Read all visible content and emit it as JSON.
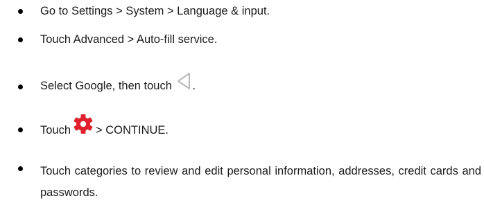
{
  "steps": [
    {
      "text": "Go to Settings > System > Language & input."
    },
    {
      "text": "Touch Advanced > Auto-fill service."
    },
    {
      "before": "Select Google, then touch",
      "icon": "back-triangle-icon",
      "after": "."
    },
    {
      "before": "Touch",
      "icon": "settings-gear-icon",
      "after": "> CONTINUE."
    },
    {
      "text": "Touch categories to review and edit personal information, addresses, credit cards and passwords."
    }
  ],
  "colors": {
    "text": "#1a1a1a",
    "bullet": "#000000",
    "back_icon": "#b8b8b8",
    "gear_icon": "#e0202c"
  }
}
